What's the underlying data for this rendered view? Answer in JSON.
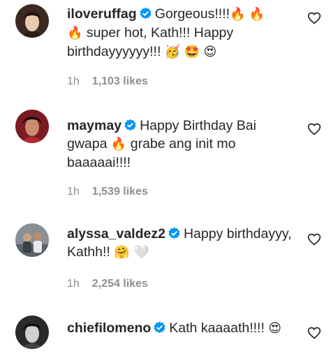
{
  "comments": [
    {
      "username": "iloveruffag",
      "parts": [
        "Gorgeous!!!!",
        "🔥",
        " ",
        "🔥",
        "🔥",
        " super hot, Kath!!! Happy birthdayyyyyy!!! ",
        "🥳",
        " ",
        "🤩",
        " ",
        "😍"
      ],
      "time": "1h",
      "likes": "1,103 likes"
    },
    {
      "username": "maymay",
      "parts": [
        "Happy Birthday Bai gwapa ",
        "🔥",
        " grabe ang init mo baaaaai!!!!"
      ],
      "time": "1h",
      "likes": "1,539 likes"
    },
    {
      "username": "alyssa_valdez2",
      "parts": [
        "Happy birthdayyy, Kathh!! ",
        "🤗",
        " ",
        "🤍"
      ],
      "time": "1h",
      "likes": "2,254 likes"
    },
    {
      "username": "chiefilomeno",
      "parts": [
        "Kath kaaaath!!!! ",
        "😍"
      ]
    }
  ],
  "icons": {
    "verified": "verified-badge-icon",
    "like": "heart-outline-icon"
  },
  "colors": {
    "text": "#262626",
    "meta": "#8e8e8e",
    "verified": "#0095f6"
  }
}
